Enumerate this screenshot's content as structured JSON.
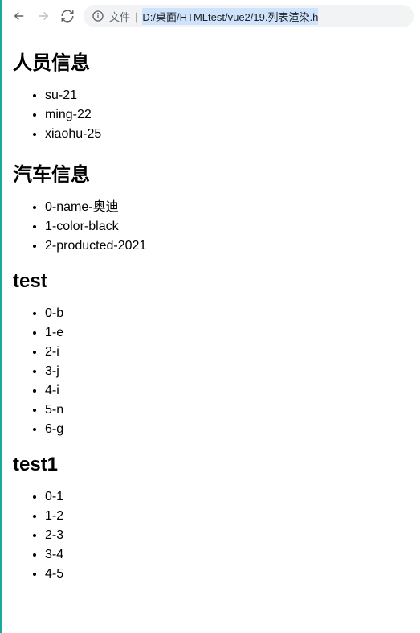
{
  "toolbar": {
    "file_label": "文件",
    "url_text": "D:/桌面/HTMLtest/vue2/19.列表渲染.h"
  },
  "sections": {
    "people": {
      "heading": "人员信息",
      "items": [
        "su-21",
        "ming-22",
        "xiaohu-25"
      ]
    },
    "car": {
      "heading": "汽车信息",
      "items": [
        "0-name-奥迪",
        "1-color-black",
        "2-producted-2021"
      ]
    },
    "test": {
      "heading": "test",
      "items": [
        "0-b",
        "1-e",
        "2-i",
        "3-j",
        "4-i",
        "5-n",
        "6-g"
      ]
    },
    "test1": {
      "heading": "test1",
      "items": [
        "0-1",
        "1-2",
        "2-3",
        "3-4",
        "4-5"
      ]
    }
  }
}
